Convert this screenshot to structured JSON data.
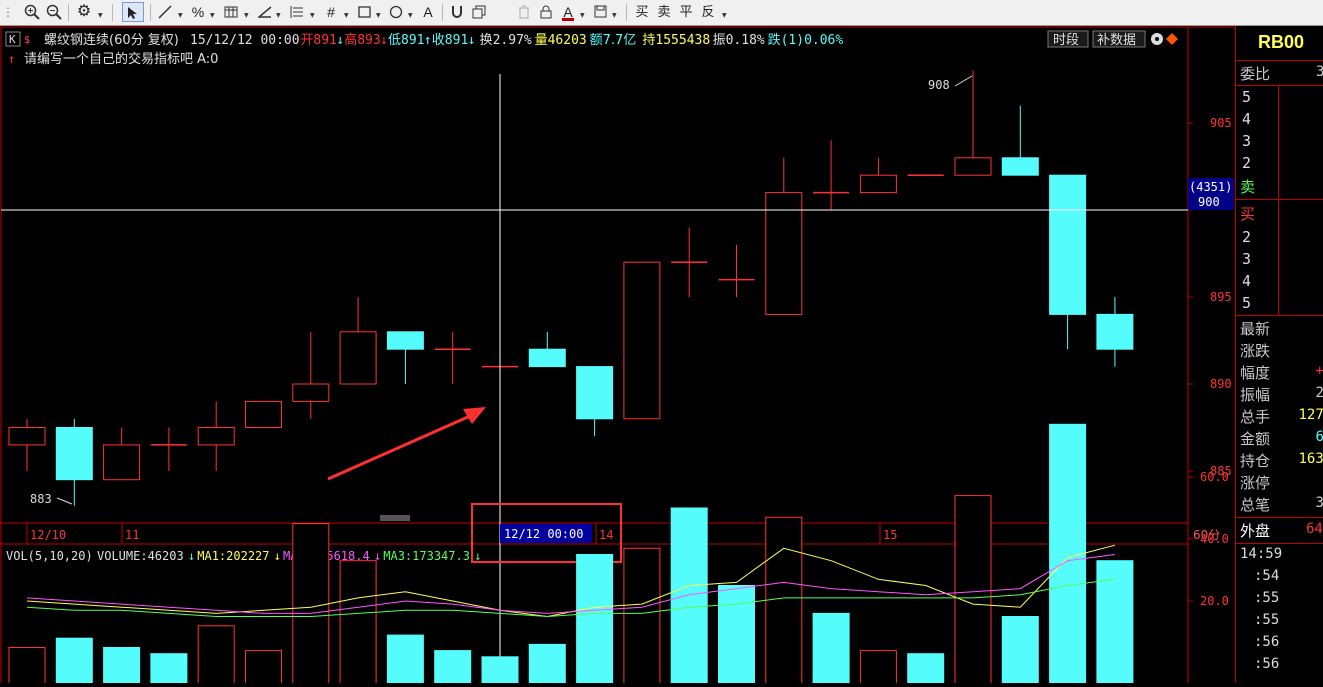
{
  "toolbar": {
    "items": [
      "zoom-in",
      "zoom-out",
      "settings",
      "cursor",
      "line",
      "percent",
      "grid",
      "angle",
      "hlines",
      "hash",
      "rect",
      "circle",
      "text",
      "magnet",
      "copy",
      "delete",
      "lock",
      "color",
      "save"
    ],
    "text_label": "A",
    "buy": "买",
    "sell": "卖",
    "flat": "平",
    "reverse": "反"
  },
  "header": {
    "k_icon": "K",
    "dollar": "$",
    "title": "螺纹钢连续(60分 复权)",
    "datetime": "15/12/12 00:00",
    "open_label": "开",
    "open_val": "891",
    "open_arrow": "↓",
    "high_label": "高",
    "high_val": "893",
    "high_arrow": "↓",
    "low_label": "低",
    "low_val": "891",
    "low_arrow": "↑",
    "close_label": "收",
    "close_val": "891",
    "close_arrow": "↓",
    "turnover_label": "换",
    "turnover_val": "2.97%",
    "volume_label": "量",
    "volume_val": "46203",
    "amount_label": "额",
    "amount_val": "7.7亿",
    "hold_label": "持",
    "hold_val": "1555438",
    "amp_label": "振",
    "amp_val": "0.18%",
    "fall_label": "跌",
    "fall_val": "(1)0.06%",
    "btn_period": "时段",
    "btn_supplement": "补数据",
    "indicator_arrow": "↑",
    "indicator": "请编写一个自己的交易指标吧 A:0"
  },
  "price_axis": [
    "905",
    "900",
    "895",
    "890",
    "885"
  ],
  "crosshair_price": "(4351)",
  "crosshair_price2": "900",
  "high_marker": "908",
  "low_marker": "883",
  "date_axis": {
    "labels": [
      "12/10",
      "11",
      "14",
      "15"
    ],
    "cursor_label": "12/12 00:00",
    "period": "60分"
  },
  "volume_header": {
    "name": "VOL(5,10,20)",
    "volume": "VOLUME:46203",
    "vol_arrow": "↓",
    "ma1": "MA1:202227",
    "ma1_arrow": "↓",
    "ma2": "MA2:155618.4",
    "ma2_arrow": "↓",
    "ma3": "MA3:173347.3",
    "ma3_arrow": "↓"
  },
  "volume_axis": [
    "60.0",
    "40.0",
    "20.0"
  ],
  "chart_data": {
    "type": "candlestick",
    "price_range": [
      882,
      910
    ],
    "candles": [
      {
        "o": 886.5,
        "h": 888,
        "l": 885,
        "c": 887.5
      },
      {
        "o": 887.5,
        "h": 888,
        "l": 883,
        "c": 884.5
      },
      {
        "o": 884.5,
        "h": 887.5,
        "l": 884.5,
        "c": 886.5
      },
      {
        "o": 886.5,
        "h": 887.5,
        "l": 885,
        "c": 886.5
      },
      {
        "o": 886.5,
        "h": 889,
        "l": 885,
        "c": 887.5
      },
      {
        "o": 887.5,
        "h": 889,
        "l": 887.5,
        "c": 889
      },
      {
        "o": 889,
        "h": 893,
        "l": 888,
        "c": 890
      },
      {
        "o": 890,
        "h": 895,
        "l": 890,
        "c": 893
      },
      {
        "o": 893,
        "h": 893,
        "l": 890,
        "c": 892
      },
      {
        "o": 892,
        "h": 893,
        "l": 890,
        "c": 892
      },
      {
        "o": 891,
        "h": 893,
        "l": 891,
        "c": 891
      },
      {
        "o": 892,
        "h": 893,
        "l": 891,
        "c": 891
      },
      {
        "o": 891,
        "h": 891,
        "l": 887,
        "c": 888
      },
      {
        "o": 888,
        "h": 897,
        "l": 888,
        "c": 897
      },
      {
        "o": 897,
        "h": 899,
        "l": 895,
        "c": 897
      },
      {
        "o": 896,
        "h": 898,
        "l": 895,
        "c": 896
      },
      {
        "o": 894,
        "h": 903,
        "l": 894,
        "c": 901
      },
      {
        "o": 901,
        "h": 904,
        "l": 900,
        "c": 901
      },
      {
        "o": 901,
        "h": 903,
        "l": 901,
        "c": 902
      },
      {
        "o": 902,
        "h": 902,
        "l": 902,
        "c": 902
      },
      {
        "o": 902,
        "h": 908,
        "l": 902,
        "c": 903
      },
      {
        "o": 903,
        "h": 906,
        "l": 902,
        "c": 902
      },
      {
        "o": 902,
        "h": 902,
        "l": 892,
        "c": 894
      },
      {
        "o": 894,
        "h": 895,
        "l": 891,
        "c": 892
      }
    ],
    "volume_range": [
      0,
      80
    ],
    "volumes": [
      {
        "v": 5,
        "up": true
      },
      {
        "v": 8,
        "up": false
      },
      {
        "v": 5,
        "up": false
      },
      {
        "v": 3,
        "up": false
      },
      {
        "v": 12,
        "up": true
      },
      {
        "v": 4,
        "up": true
      },
      {
        "v": 45,
        "up": true
      },
      {
        "v": 33,
        "up": true
      },
      {
        "v": 9,
        "up": false
      },
      {
        "v": 4,
        "up": false
      },
      {
        "v": 2,
        "up": false
      },
      {
        "v": 6,
        "up": false
      },
      {
        "v": 35,
        "up": false
      },
      {
        "v": 37,
        "up": true
      },
      {
        "v": 50,
        "up": false
      },
      {
        "v": 25,
        "up": false
      },
      {
        "v": 47,
        "up": true
      },
      {
        "v": 16,
        "up": false
      },
      {
        "v": 4,
        "up": true
      },
      {
        "v": 3,
        "up": false
      },
      {
        "v": 54,
        "up": true
      },
      {
        "v": 15,
        "up": false
      },
      {
        "v": 77,
        "up": false
      },
      {
        "v": 33,
        "up": false
      }
    ],
    "ma1": [
      20,
      19,
      18,
      17,
      16,
      17,
      18,
      21,
      23,
      20,
      17,
      15,
      18,
      19,
      25,
      26,
      37,
      33,
      27,
      25,
      19,
      18,
      34,
      38
    ],
    "ma2": [
      21,
      20,
      19,
      18,
      17,
      16,
      16,
      18,
      20,
      19,
      17,
      16,
      17,
      18,
      22,
      24,
      26,
      24,
      23,
      22,
      23,
      24,
      33,
      35
    ],
    "ma3": [
      18,
      17,
      17,
      16,
      15,
      15,
      15,
      16,
      17,
      17,
      16,
      15,
      16,
      16,
      18,
      19,
      21,
      21,
      21,
      21,
      21,
      22,
      25,
      27
    ]
  },
  "right_panel": {
    "code": "RB00",
    "weibi": "委比",
    "weibi_val": "3",
    "sell_levels": [
      "5",
      "4",
      "3",
      "2"
    ],
    "sell_label": "卖",
    "buy_label": "买",
    "buy_levels": [
      "2",
      "3",
      "4",
      "5"
    ],
    "stats": [
      {
        "label": "最新",
        "val": ""
      },
      {
        "label": "涨跌",
        "val": ""
      },
      {
        "label": "幅度",
        "val": "+"
      },
      {
        "label": "振幅",
        "val": "2"
      },
      {
        "label": "总手",
        "val": "127"
      },
      {
        "label": "金额",
        "val": "6"
      },
      {
        "label": "持仓",
        "val": "163"
      },
      {
        "label": "涨停",
        "val": ""
      },
      {
        "label": "总笔",
        "val": "3"
      }
    ],
    "outer": "外盘",
    "outer_val": "64",
    "times": [
      "14:59",
      ":54",
      ":55",
      ":55",
      ":56",
      ":56"
    ]
  },
  "colors": {
    "up": "#ff3232",
    "down": "#54fcfc",
    "ma1": "#ffff55",
    "ma2": "#ff55ff",
    "ma3": "#55ff55",
    "border": "#c00000"
  }
}
